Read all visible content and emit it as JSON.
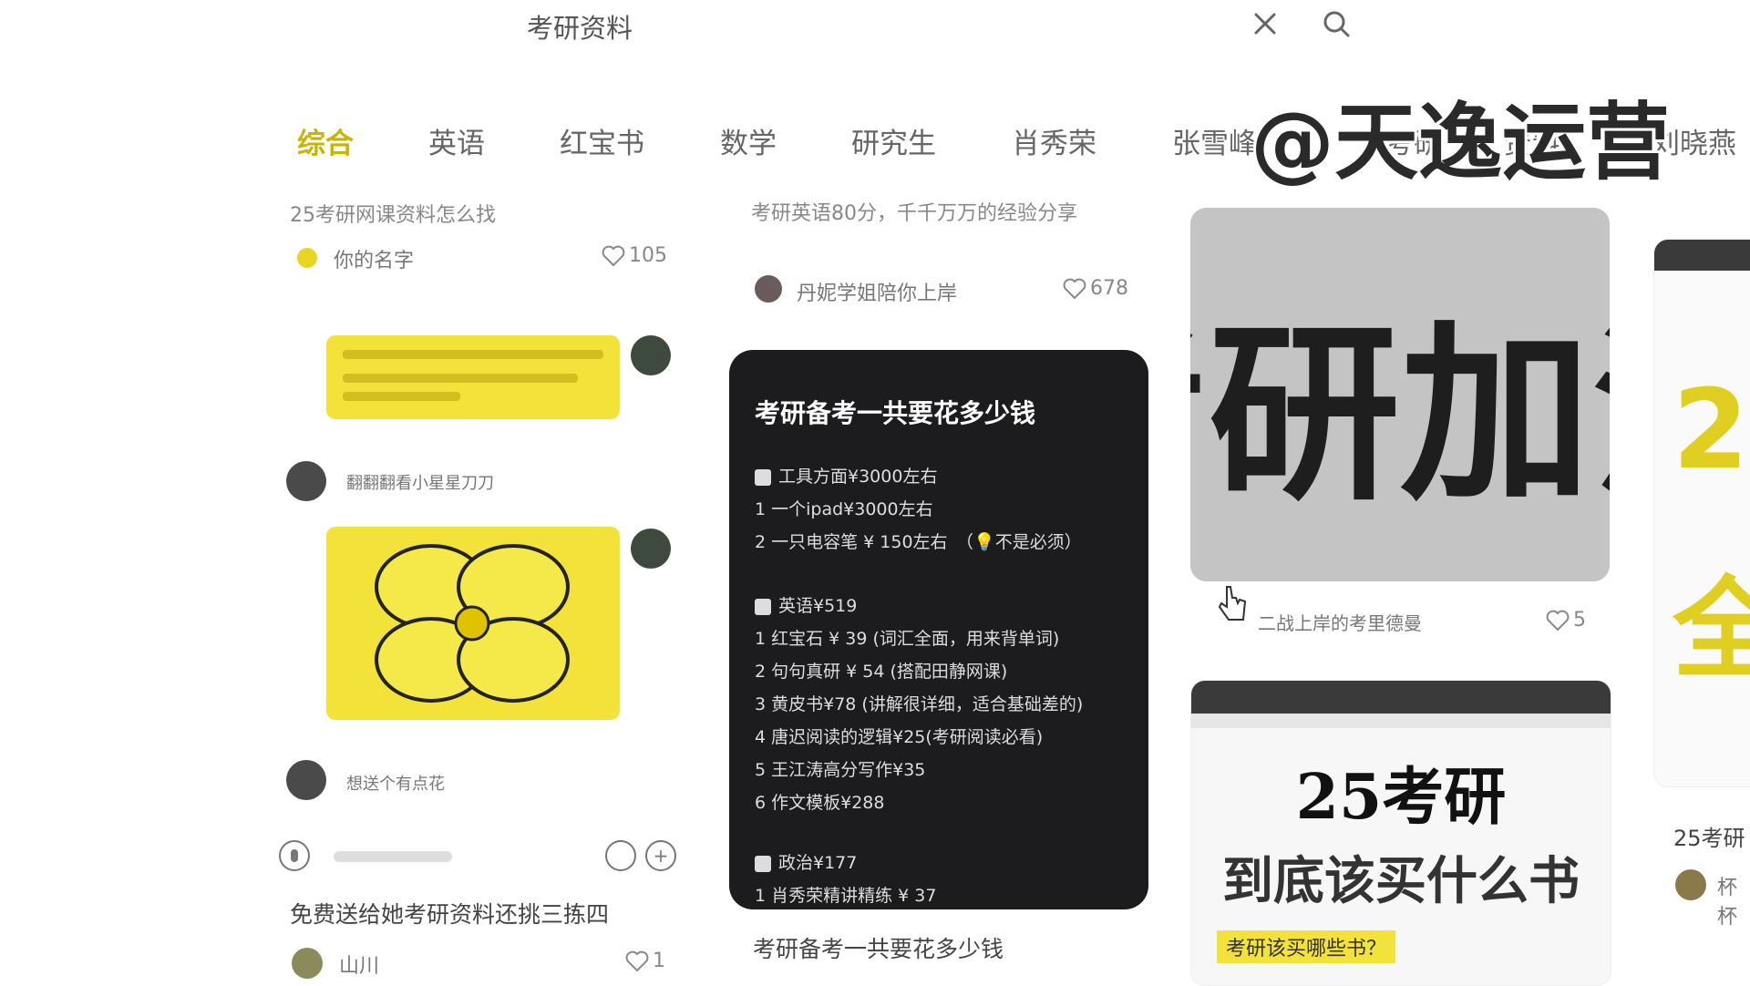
{
  "search": {
    "query": "考研资料"
  },
  "tabs": [
    "综合",
    "英语",
    "红宝书",
    "数学",
    "研究生",
    "肖秀荣",
    "张雪峰",
    "考研",
    "资料",
    "刘晓燕"
  ],
  "watermark": "@天逸运营",
  "col1": {
    "top_title": "25考研网课资料怎么找",
    "top_author": "你的名字",
    "top_likes": "105",
    "chat_name": "翻翻翻看小星星刀刀",
    "chat_bottom_name": "想送个有点花",
    "post_title": "免费送给她考研资料还挑三拣四",
    "post_author": "山川",
    "post_likes": "1"
  },
  "col2": {
    "top_title": "考研英语80分，千千万万的经验分享",
    "top_author": "丹妮学姐陪你上岸",
    "top_likes": "678",
    "card": {
      "title": "考研备考一共要花多少钱",
      "sections": [
        {
          "head": "工具方面¥3000左右",
          "items": [
            "1 一个ipad¥3000左右",
            "2 一只电容笔 ¥ 150左右　（💡不是必须）"
          ]
        },
        {
          "head": "英语¥519",
          "items": [
            "1 红宝石 ¥ 39 (词汇全面，用来背单词)",
            "2 句句真研 ¥ 54 (搭配田静网课)",
            "3 黄皮书¥78 (讲解很详细，适合基础差的)",
            "4 唐迟阅读的逻辑¥25(考研阅读必看)",
            "5 王江涛高分写作¥35",
            "6 作文模板¥288"
          ]
        },
        {
          "head": "政治¥177",
          "items": [
            "1 肖秀荣精讲精练 ¥ 37"
          ]
        }
      ]
    },
    "post_title": "考研备考一共要花多少钱"
  },
  "col3": {
    "photo_text": "考研加油",
    "author": "二战上岸的考里德曼",
    "likes": "5",
    "thumb_title1": "25考研",
    "thumb_title2": "到底该买什么书",
    "thumb_sub": "考研该买哪些书？"
  },
  "col4": {
    "title": "25考研",
    "author": "杯杯"
  }
}
